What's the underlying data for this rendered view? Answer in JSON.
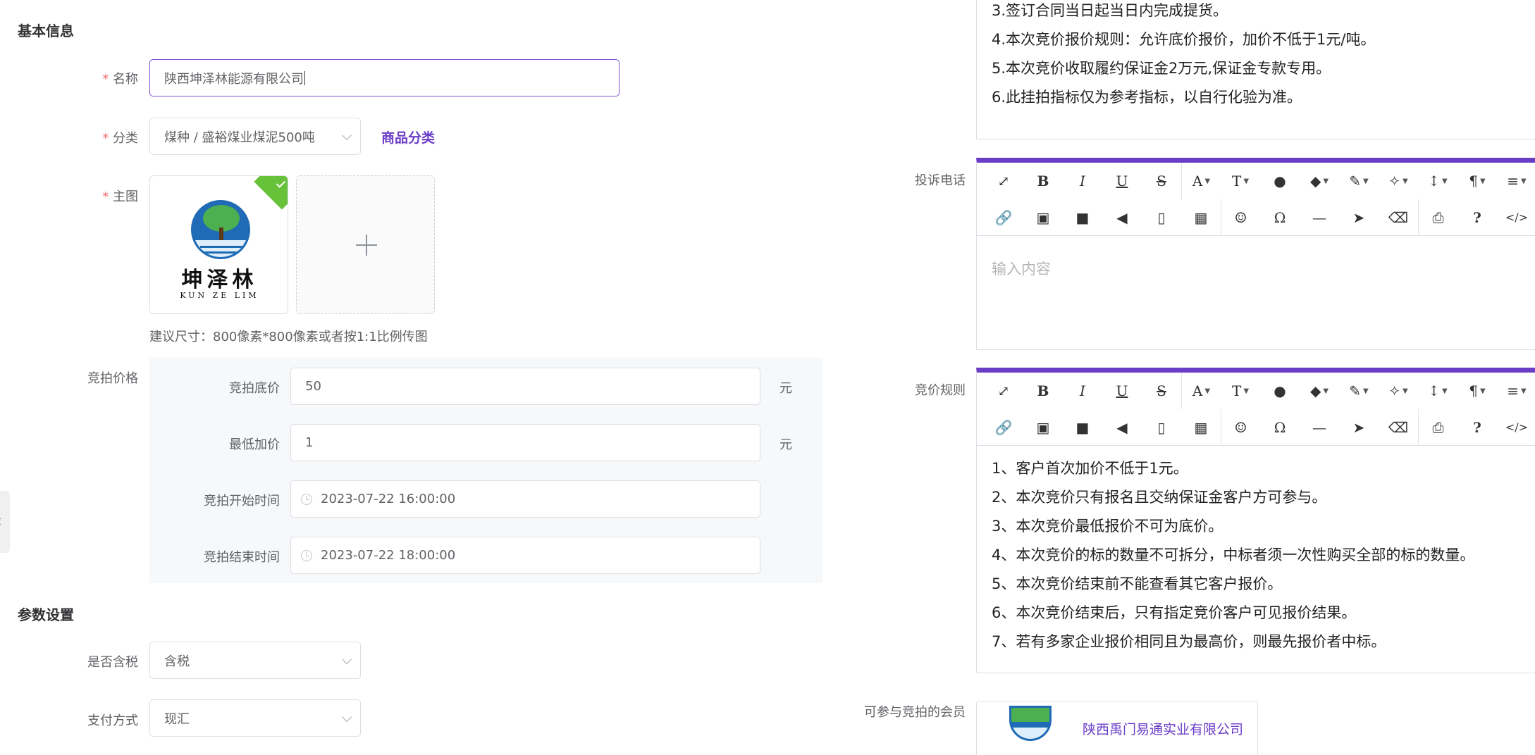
{
  "basic": {
    "section_title": "基本信息",
    "name": {
      "label": "名称",
      "value": "陕西坤泽林能源有限公司"
    },
    "category": {
      "label": "分类",
      "value": "煤种 / 盛裕煤业煤泥500吨",
      "link": "商品分类"
    },
    "main_image": {
      "label": "主图",
      "logo_text": "坤泽林",
      "logo_sub": "KUN ZE LIM",
      "hint": "建议尺寸：800像素*800像素或者按1:1比例传图"
    }
  },
  "pricing": {
    "label": "竞拍价格",
    "base_price": {
      "label": "竞拍底价",
      "value": "50",
      "unit": "元"
    },
    "min_increment": {
      "label": "最低加价",
      "value": "1",
      "unit": "元"
    },
    "start_time": {
      "label": "竞拍开始时间",
      "value": "2023-07-22 16:00:00"
    },
    "end_time": {
      "label": "竞拍结束时间",
      "value": "2023-07-22 18:00:00"
    }
  },
  "params": {
    "section_title": "参数设置",
    "tax": {
      "label": "是否含税",
      "value": "含税"
    },
    "payment": {
      "label": "支付方式",
      "value": "现汇"
    }
  },
  "notes_editor": {
    "lines": [
      "3.签订合同当日起当日内完成提货。",
      "4.本次竞价报价规则：允许底价报价，加价不低于1元/吨。",
      "5.本次竞价收取履约保证金2万元,保证金专款专用。",
      "6.此挂拍指标仅为参考指标，以自行化验为准。"
    ]
  },
  "complaint_editor": {
    "label": "投诉电话",
    "placeholder": "输入内容"
  },
  "rules_editor": {
    "label": "竞价规则",
    "lines": [
      "1、客户首次加价不低于1元。",
      "2、本次竞价只有报名且交纳保证金客户方可参与。",
      "3、本次竞价最低报价不可为底价。",
      "4、本次竞价的标的数量不可拆分，中标者须一次性购买全部的标的数量。",
      "5、本次竞价结束前不能查看其它客户报价。",
      "6、本次竞价结束后，只有指定竞价客户可见报价结果。",
      "7、若有多家企业报价相同且为最高价，则最先报价者中标。"
    ]
  },
  "members": {
    "label": "可参与竞拍的会员",
    "company": "陕西禹门易通实业有限公司"
  },
  "toolbar": {
    "row1": [
      "expand-icon",
      "bold-icon",
      "italic-icon",
      "underline-icon",
      "strikethrough-icon",
      "font-color-icon",
      "font-size-icon",
      "ink-icon",
      "tag-icon",
      "brush-icon",
      "magic-wand-icon",
      "line-height-icon",
      "paragraph-icon",
      "align-icon"
    ],
    "row2": [
      "link-icon",
      "image-icon",
      "video-icon",
      "audio-icon",
      "file-icon",
      "table-icon",
      "emoji-icon",
      "omega-icon",
      "hr-icon",
      "cursor-icon",
      "eraser-icon",
      "print-icon",
      "help-icon",
      "code-icon"
    ]
  },
  "colors": {
    "accent": "#6a3dc7",
    "required": "#f56c6c",
    "border": "#dcdfe6"
  }
}
